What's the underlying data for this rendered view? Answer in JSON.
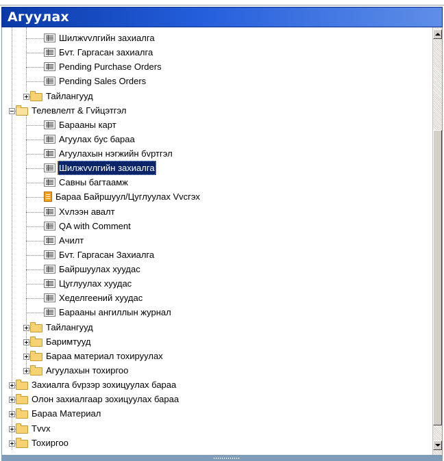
{
  "window": {
    "title": "Агуулах"
  },
  "tree": {
    "items": [
      {
        "label": "Шилжvvлгийн захиалга",
        "icon": "form-icon",
        "level": 2,
        "expander": "none",
        "selected": false
      },
      {
        "label": "Бvт. Гаргасан захиалга",
        "icon": "form-icon",
        "level": 2,
        "expander": "none",
        "selected": false
      },
      {
        "label": "Pending Purchase Orders",
        "icon": "form-icon",
        "level": 2,
        "expander": "none",
        "selected": false
      },
      {
        "label": "Pending Sales Orders",
        "icon": "form-icon",
        "level": 2,
        "expander": "none",
        "selected": false
      },
      {
        "label": "Тайлангууд",
        "icon": "folder-icon",
        "level": 1,
        "expander": "plus",
        "selected": false
      },
      {
        "label": "Телевлелт & Гvйцэтгэл",
        "icon": "folder-open-icon",
        "level": 0,
        "expander": "minus",
        "selected": false
      },
      {
        "label": "Барааны карт",
        "icon": "form-icon",
        "level": 2,
        "expander": "none",
        "selected": false
      },
      {
        "label": "Агуулах бус бараа",
        "icon": "form-icon",
        "level": 2,
        "expander": "none",
        "selected": false
      },
      {
        "label": "Агуулахын нэгжийн бvртгэл",
        "icon": "form-icon",
        "level": 2,
        "expander": "none",
        "selected": false
      },
      {
        "label": "Шилжvvлгийн захиалга",
        "icon": "form-icon",
        "level": 2,
        "expander": "none",
        "selected": true
      },
      {
        "label": "Савны багтаамж",
        "icon": "form-icon",
        "level": 2,
        "expander": "none",
        "selected": false
      },
      {
        "label": "Бараа Байршуул/Цуглуулах Vvсгэх",
        "icon": "report-icon",
        "level": 2,
        "expander": "none",
        "selected": false
      },
      {
        "label": "Хvлээн авалт",
        "icon": "form-icon",
        "level": 2,
        "expander": "none",
        "selected": false
      },
      {
        "label": "QA with Comment",
        "icon": "form-icon",
        "level": 2,
        "expander": "none",
        "selected": false
      },
      {
        "label": "Ачилт",
        "icon": "form-icon",
        "level": 2,
        "expander": "none",
        "selected": false
      },
      {
        "label": "Бvт. Гаргасан Захиалга",
        "icon": "form-icon",
        "level": 2,
        "expander": "none",
        "selected": false
      },
      {
        "label": "Байршуулах хуудас",
        "icon": "form-icon",
        "level": 2,
        "expander": "none",
        "selected": false
      },
      {
        "label": "Цуглуулах хуудас",
        "icon": "form-icon",
        "level": 2,
        "expander": "none",
        "selected": false
      },
      {
        "label": "Хеделгеений хуудас",
        "icon": "form-icon",
        "level": 2,
        "expander": "none",
        "selected": false
      },
      {
        "label": "Барааны ангиллын журнал",
        "icon": "form-icon",
        "level": 2,
        "expander": "none",
        "selected": false
      },
      {
        "label": "Тайлангууд",
        "icon": "folder-icon",
        "level": 1,
        "expander": "plus",
        "selected": false
      },
      {
        "label": "Баримтууд",
        "icon": "folder-icon",
        "level": 1,
        "expander": "plus",
        "selected": false
      },
      {
        "label": "Бараа материал тохируулах",
        "icon": "folder-icon",
        "level": 1,
        "expander": "plus",
        "selected": false
      },
      {
        "label": "Агуулахын тохиргоо",
        "icon": "folder-icon",
        "level": 1,
        "expander": "plus",
        "selected": false
      },
      {
        "label": "Захиалга бvрзэр зохицуулах бараа",
        "icon": "folder-icon",
        "level": 0,
        "expander": "plus",
        "selected": false
      },
      {
        "label": "Олон захиалгаар зохицуулах бараа",
        "icon": "folder-icon",
        "level": 0,
        "expander": "plus",
        "selected": false
      },
      {
        "label": "Бараа Материал",
        "icon": "folder-icon",
        "level": 0,
        "expander": "plus",
        "selected": false
      },
      {
        "label": "Тvvх",
        "icon": "folder-icon",
        "level": 0,
        "expander": "plus",
        "selected": false
      },
      {
        "label": "Тохиргоо",
        "icon": "folder-icon",
        "level": 0,
        "expander": "plus",
        "selected": false
      }
    ]
  },
  "scrollbar": {
    "up_icon": "arrow-up-icon",
    "down_icon": "arrow-down-icon"
  },
  "colors": {
    "title_bar": "#245edb",
    "selection": "#0a246a"
  }
}
